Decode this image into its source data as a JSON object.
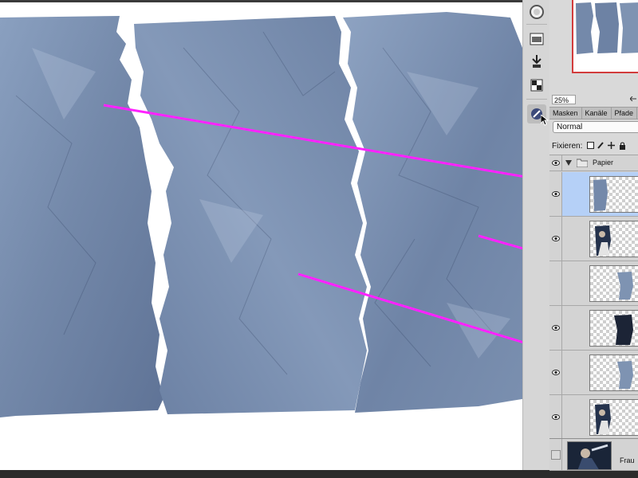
{
  "toolbar": {
    "items": [
      {
        "name": "history-brush-icon"
      },
      {
        "name": "screen-mode-icon"
      },
      {
        "name": "clone-source-icon"
      },
      {
        "name": "channel-mixer-icon"
      },
      {
        "name": "mask-edit-icon"
      }
    ]
  },
  "navigator": {
    "zoom": "25%"
  },
  "panel_tabs": [
    {
      "label": "Masken",
      "active": false
    },
    {
      "label": "Kanäle",
      "active": false
    },
    {
      "label": "Pfade",
      "active": false
    }
  ],
  "layers": {
    "blend_mode": "Normal",
    "lock_label": "Fixieren:",
    "group": {
      "name": "Papier",
      "expanded": true
    },
    "rows": [
      {
        "kind": "paper-piece",
        "visible": true,
        "selected": true
      },
      {
        "kind": "woman-piece",
        "visible": true,
        "selected": false
      },
      {
        "kind": "paper-piece-small",
        "visible": false,
        "selected": false
      },
      {
        "kind": "dark-piece",
        "visible": true,
        "selected": false
      },
      {
        "kind": "paper-piece-small",
        "visible": true,
        "selected": false
      },
      {
        "kind": "woman-piece",
        "visible": true,
        "selected": false
      }
    ],
    "background_layer": {
      "name": "Frau",
      "visible": false
    }
  },
  "annotations": {
    "arrow_color": "#ff22ff",
    "arrows": 3
  },
  "colors": {
    "paper_blue": "#7e93b2",
    "selection_blue": "#b5d0f7",
    "navigator_frame": "#d23c3c"
  }
}
